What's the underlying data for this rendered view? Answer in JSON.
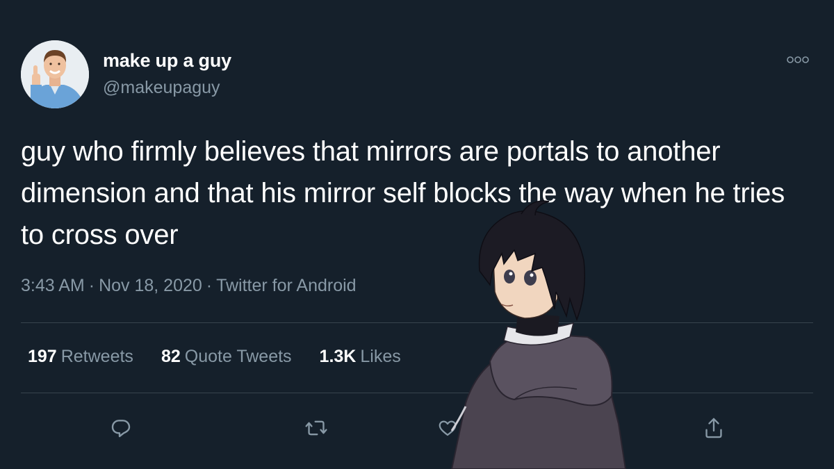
{
  "tweet": {
    "author": {
      "display_name": "make up a guy",
      "handle": "@makeupaguy"
    },
    "text": "guy who firmly believes that mirrors are portals to another dimension and that his mirror self blocks the way when he tries to cross over",
    "time": "3:43 AM",
    "date": "Nov 18, 2020",
    "source": "Twitter for Android",
    "separator": "·",
    "stats": {
      "retweets_count": "197",
      "retweets_label": "Retweets",
      "quote_count": "82",
      "quote_label": "Quote Tweets",
      "likes_count": "1.3K",
      "likes_label": "Likes"
    }
  },
  "icons": {
    "more": "more-horizontal-icon",
    "reply": "reply-icon",
    "retweet": "retweet-icon",
    "like": "heart-icon",
    "share": "share-icon"
  },
  "colors": {
    "background": "#15202b",
    "text_primary": "#ffffff",
    "text_secondary": "#8899a6",
    "divider": "#38444d"
  }
}
